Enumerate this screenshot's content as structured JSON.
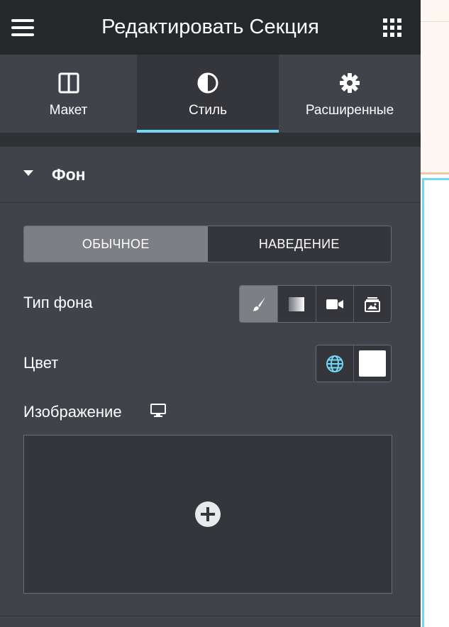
{
  "header": {
    "title": "Редактировать Секция",
    "menu_icon": "hamburger-menu-icon",
    "apps_icon": "grid-apps-icon"
  },
  "tabs": [
    {
      "label": "Макет",
      "icon": "layout-columns-icon",
      "active": false
    },
    {
      "label": "Стиль",
      "icon": "contrast-half-circle-icon",
      "active": true
    },
    {
      "label": "Расширенные",
      "icon": "gear-icon",
      "active": false
    }
  ],
  "section": {
    "title": "Фон",
    "expanded": true
  },
  "state_toggle": {
    "options": [
      "ОБЫЧНОЕ",
      "НАВЕДЕНИЕ"
    ],
    "selected": "ОБЫЧНОЕ"
  },
  "background_type": {
    "label": "Тип фона",
    "options": [
      "brush-classic-icon",
      "gradient-icon",
      "video-camera-icon",
      "slideshow-icon"
    ],
    "selected": "brush-classic-icon"
  },
  "color": {
    "label": "Цвет",
    "global_icon": "globe-icon",
    "value": "#ffffff"
  },
  "image": {
    "label": "Изображение",
    "responsive_icon": "monitor-icon",
    "add_icon": "plus-circle-icon"
  },
  "colors": {
    "panel_bg": "#404349",
    "header_bg": "#26292c",
    "accent": "#71d7f7",
    "control_dark": "#34363b",
    "control_active": "#7d7f84"
  }
}
